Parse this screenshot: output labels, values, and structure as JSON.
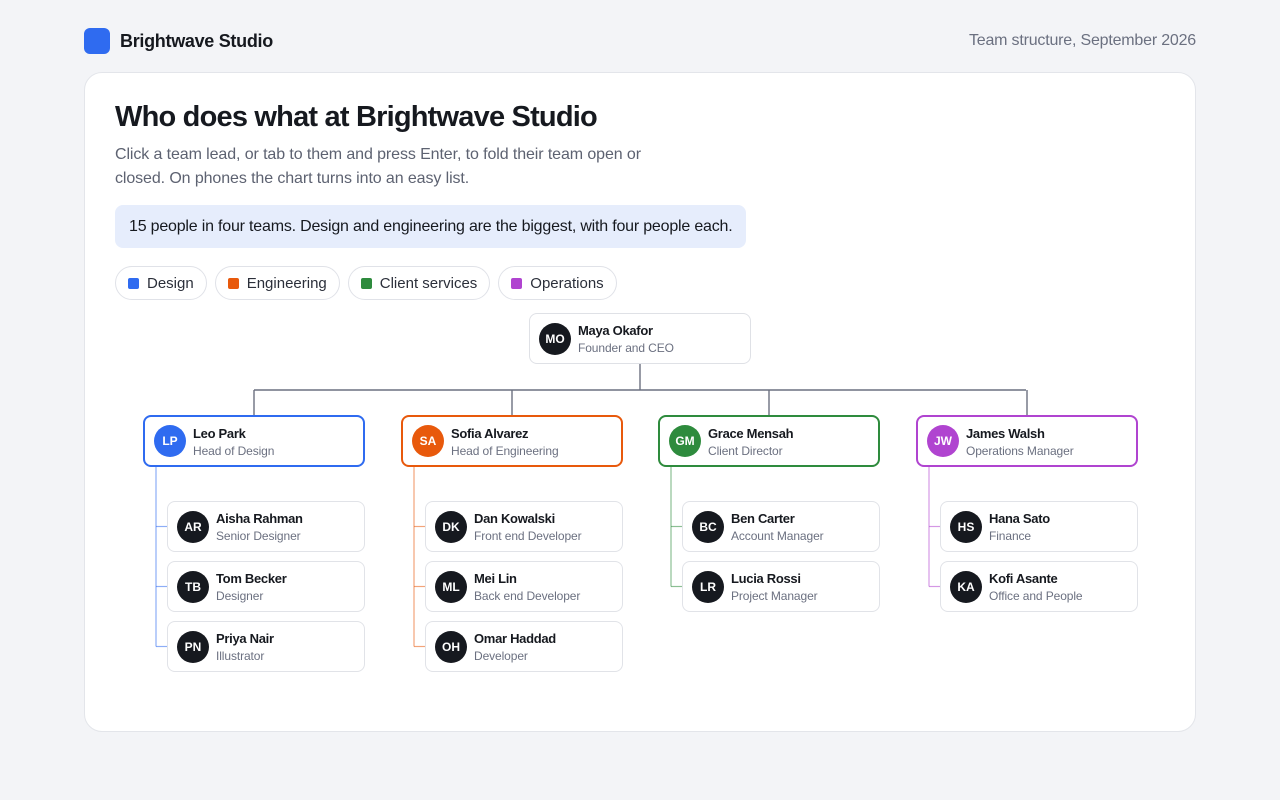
{
  "header": {
    "brand": "Brightwave Studio",
    "context": "Team structure, September 2026"
  },
  "main": {
    "title": "Who does what at Brightwave Studio",
    "intro": "Click a team lead, or tab to them and press Enter, to fold their team open or closed. On phones the chart turns into an easy list.",
    "summary": "15 people in four teams. Design and engineering are the biggest, with four people each."
  },
  "legend": [
    {
      "label": "Design",
      "color": "#2f6bf0"
    },
    {
      "label": "Engineering",
      "color": "#e8590c"
    },
    {
      "label": "Client services",
      "color": "#2e8b3d"
    },
    {
      "label": "Operations",
      "color": "#b044d0"
    }
  ],
  "org": {
    "ceo": {
      "initials": "MO",
      "name": "Maya Okafor",
      "role": "Founder and CEO"
    },
    "teams": [
      {
        "lead": {
          "initials": "LP",
          "name": "Leo Park",
          "role": "Head of Design"
        },
        "color": "#2f6bf0",
        "members": [
          {
            "initials": "AR",
            "name": "Aisha Rahman",
            "role": "Senior Designer"
          },
          {
            "initials": "TB",
            "name": "Tom Becker",
            "role": "Designer"
          },
          {
            "initials": "PN",
            "name": "Priya Nair",
            "role": "Illustrator"
          }
        ]
      },
      {
        "lead": {
          "initials": "SA",
          "name": "Sofia Alvarez",
          "role": "Head of Engineering"
        },
        "color": "#e8590c",
        "members": [
          {
            "initials": "DK",
            "name": "Dan Kowalski",
            "role": "Front end Developer"
          },
          {
            "initials": "ML",
            "name": "Mei Lin",
            "role": "Back end Developer"
          },
          {
            "initials": "OH",
            "name": "Omar Haddad",
            "role": "Developer"
          }
        ]
      },
      {
        "lead": {
          "initials": "GM",
          "name": "Grace Mensah",
          "role": "Client Director"
        },
        "color": "#2e8b3d",
        "members": [
          {
            "initials": "BC",
            "name": "Ben Carter",
            "role": "Account Manager"
          },
          {
            "initials": "LR",
            "name": "Lucia Rossi",
            "role": "Project Manager"
          }
        ]
      },
      {
        "lead": {
          "initials": "JW",
          "name": "James Walsh",
          "role": "Operations Manager"
        },
        "color": "#b044d0",
        "members": [
          {
            "initials": "HS",
            "name": "Hana Sato",
            "role": "Finance"
          },
          {
            "initials": "KA",
            "name": "Kofi Asante",
            "role": "Office and People"
          }
        ]
      }
    ]
  }
}
